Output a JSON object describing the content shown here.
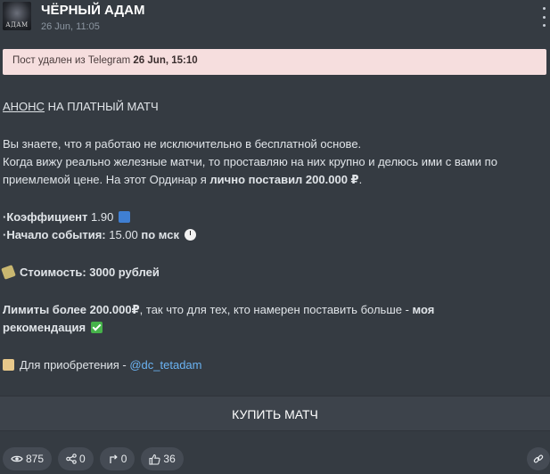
{
  "channel": {
    "title": "ЧЁРНЫЙ АДАМ",
    "date": "26 Jun, 11:05",
    "avatar_text": "АДАМ"
  },
  "notice": {
    "text": "Пост удален из Telegram",
    "date": "26 Jun, 15:10"
  },
  "post": {
    "heading_link": "АНОНС",
    "heading_rest": " НА ПЛАТНЫЙ МАТЧ",
    "p1": "Вы знаете, что я работаю не исключительно в бесплатной основе.",
    "p2": "Когда вижу реально железные матчи, то проставляю на них крупно и делюсь ими с вами по",
    "p3_start": "приемлемой цене. На этот Ординар я ",
    "p3_bold": "лично поставил 200.000 ₽",
    "p3_end": ".",
    "coef_label": "·Коэффициент",
    "coef_value": " 1.90",
    "start_label": "·Начало события:",
    "start_value": " 15.00 ",
    "start_tz": "по мск",
    "cost": "Стоимость: 3000 рублей",
    "limits_bold": "Лимиты более 200.000₽",
    "limits_rest": ", так что для тех, кто намерен поставить больше - ",
    "limits_rec1": "моя",
    "limits_rec2": "рекомендация",
    "buy_prefix": "Для приобретения - ",
    "buy_mention": "@dc_tetadam"
  },
  "buy_button": {
    "label": "КУПИТЬ МАТЧ"
  },
  "stats": {
    "views": "875",
    "forwards": "0",
    "replies": "0",
    "reactions": "36"
  },
  "colors": {
    "background": "#353b42",
    "notice_bg": "#f6dede",
    "mention": "#6ab3f3",
    "button_bg": "#3d434b"
  },
  "icons": {
    "views": "eye-icon",
    "forwards": "share-icon",
    "replies": "reply-arrow-icon",
    "reactions": "thumbs-up-icon",
    "link": "link-icon",
    "menu": "more-vertical-icon"
  }
}
